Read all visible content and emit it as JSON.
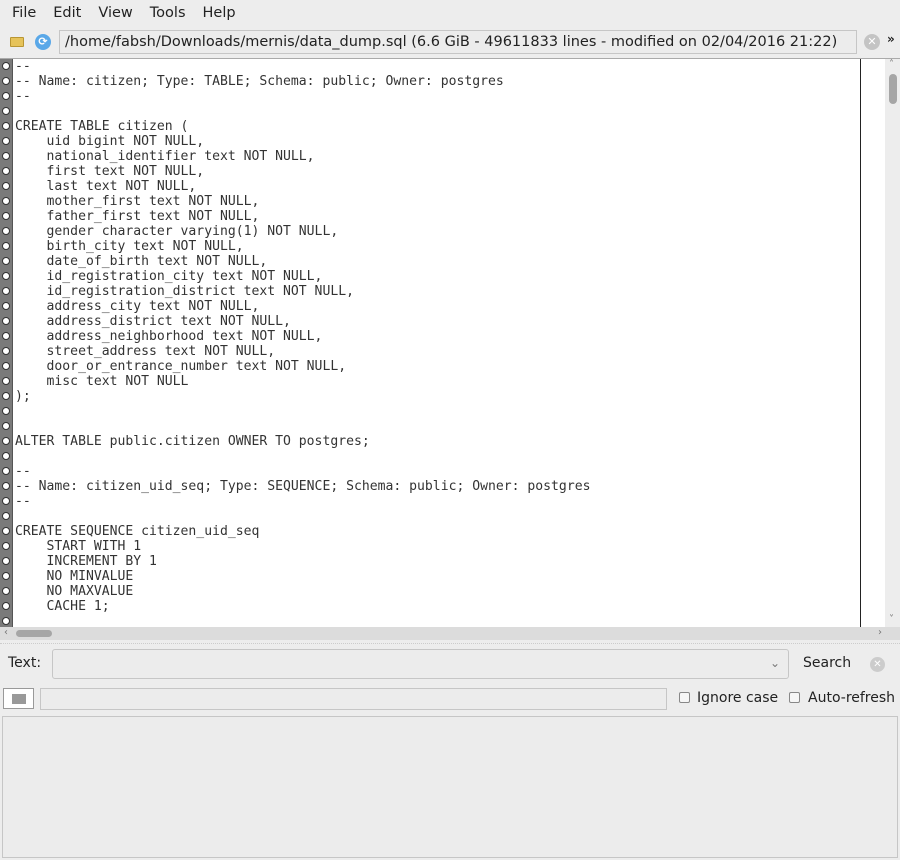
{
  "menu": [
    "File",
    "Edit",
    "View",
    "Tools",
    "Help"
  ],
  "toolbar": {
    "path": "/home/fabsh/Downloads/mernis/data_dump.sql (6.6 GiB - 49611833 lines - modified on 02/04/2016 21:22)",
    "more": "»"
  },
  "editor": {
    "lines": [
      "--",
      "-- Name: citizen; Type: TABLE; Schema: public; Owner: postgres",
      "--",
      "",
      "CREATE TABLE citizen (",
      "    uid bigint NOT NULL,",
      "    national_identifier text NOT NULL,",
      "    first text NOT NULL,",
      "    last text NOT NULL,",
      "    mother_first text NOT NULL,",
      "    father_first text NOT NULL,",
      "    gender character varying(1) NOT NULL,",
      "    birth_city text NOT NULL,",
      "    date_of_birth text NOT NULL,",
      "    id_registration_city text NOT NULL,",
      "    id_registration_district text NOT NULL,",
      "    address_city text NOT NULL,",
      "    address_district text NOT NULL,",
      "    address_neighborhood text NOT NULL,",
      "    street_address text NOT NULL,",
      "    door_or_entrance_number text NOT NULL,",
      "    misc text NOT NULL",
      ");",
      "",
      "",
      "ALTER TABLE public.citizen OWNER TO postgres;",
      "",
      "--",
      "-- Name: citizen_uid_seq; Type: SEQUENCE; Schema: public; Owner: postgres",
      "--",
      "",
      "CREATE SEQUENCE citizen_uid_seq",
      "    START WITH 1",
      "    INCREMENT BY 1",
      "    NO MINVALUE",
      "    NO MAXVALUE",
      "    CACHE 1;"
    ]
  },
  "search": {
    "text_label": "Text:",
    "text_value": "",
    "search_button": "Search",
    "filter_value": "",
    "ignore_case": "Ignore case",
    "ignore_case_checked": false,
    "auto_refresh": "Auto-refresh",
    "auto_refresh_checked": false
  }
}
